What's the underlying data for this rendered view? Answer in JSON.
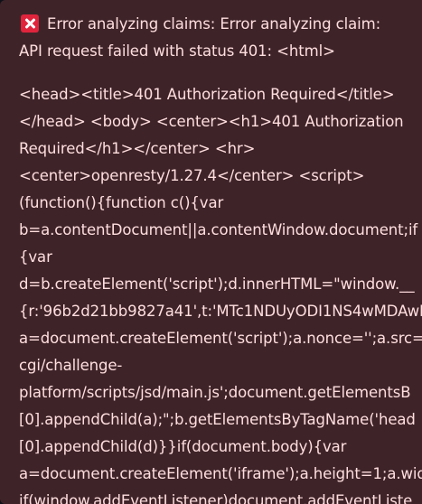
{
  "alert": {
    "icon": "cross-mark-icon",
    "colors": {
      "background": "#3e2429",
      "text": "#ffdede",
      "icon": "#e0243c"
    },
    "title_lines": [
      "Error analyzing claims: Error analyzing claim:",
      "API request failed with status 401: <html>"
    ],
    "body_lines": [
      "<head><title>401 Authorization Required</title>",
      "</head> <body> <center><h1>401 Authorization",
      "Required</h1></center> <hr>",
      "<center>openresty/1.27.4</center> <script>",
      "(function(){function c(){var",
      "b=a.contentDocument||a.contentWindow.document;if",
      "{var",
      "d=b.createElement('script');d.innerHTML=\"window.__",
      "{r:'96b2d21bb9827a41',t:'MTc1NDUyODI1NS4wMDAwM",
      "a=document.createElement('script');a.nonce='';a.src=",
      "cgi/challenge-",
      "platform/scripts/jsd/main.js';document.getElementsB",
      "[0].appendChild(a);\";b.getElementsByTagName('head",
      "[0].appendChild(d)}}if(document.body){var",
      "a=document.createElement('iframe');a.height=1;a.wid",
      "if(window.addEventListener)document.addEventListe"
    ]
  }
}
